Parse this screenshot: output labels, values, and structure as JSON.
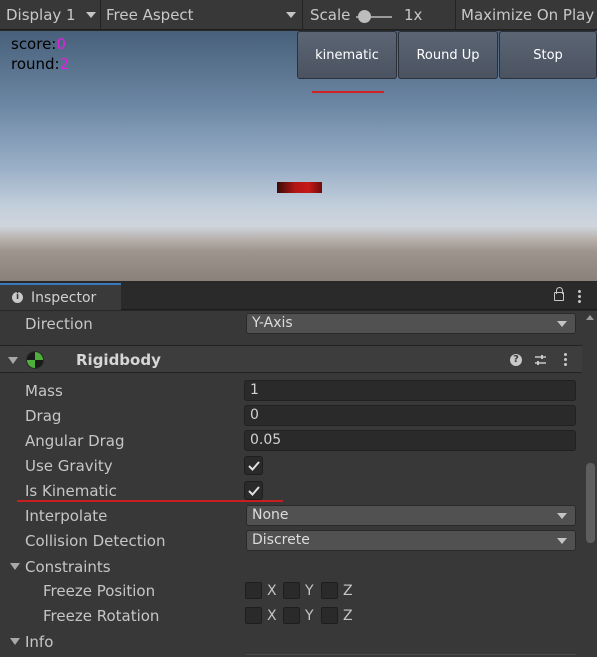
{
  "toolbar": {
    "display": "Display 1",
    "aspect": "Free Aspect",
    "scale_label": "Scale",
    "scale_value": "1x",
    "maximize": "Maximize On Play"
  },
  "hud": {
    "score_label": "score:",
    "score_value": "0",
    "round_label": "round:",
    "round_value": "2"
  },
  "game_buttons": {
    "kinematic": "kinematic",
    "round_up": "Round Up",
    "stop": "Stop"
  },
  "inspector": {
    "tab": "Inspector",
    "direction_label": "Direction",
    "direction_value": "Y-Axis",
    "component_title": "Rigidbody",
    "mass_label": "Mass",
    "mass_value": "1",
    "drag_label": "Drag",
    "drag_value": "0",
    "angular_drag_label": "Angular Drag",
    "angular_drag_value": "0.05",
    "use_gravity_label": "Use Gravity",
    "use_gravity_checked": true,
    "is_kinematic_label": "Is Kinematic",
    "is_kinematic_checked": true,
    "interpolate_label": "Interpolate",
    "interpolate_value": "None",
    "collision_label": "Collision Detection",
    "collision_value": "Discrete",
    "constraints_label": "Constraints",
    "freeze_position_label": "Freeze Position",
    "freeze_rotation_label": "Freeze Rotation",
    "axis_x": "X",
    "axis_y": "Y",
    "axis_z": "Z",
    "info_label": "Info"
  },
  "colors": {
    "hud_value": "#e020e0",
    "annotation_red": "#d32222",
    "accent_tab": "#3a79bb"
  },
  "icons": [
    "chevron-down-icon",
    "info-icon",
    "lock-icon",
    "kebab-menu-icon",
    "rigidbody-icon",
    "help-icon",
    "preset-icon",
    "checkmark-icon",
    "fold-arrow-icon"
  ]
}
